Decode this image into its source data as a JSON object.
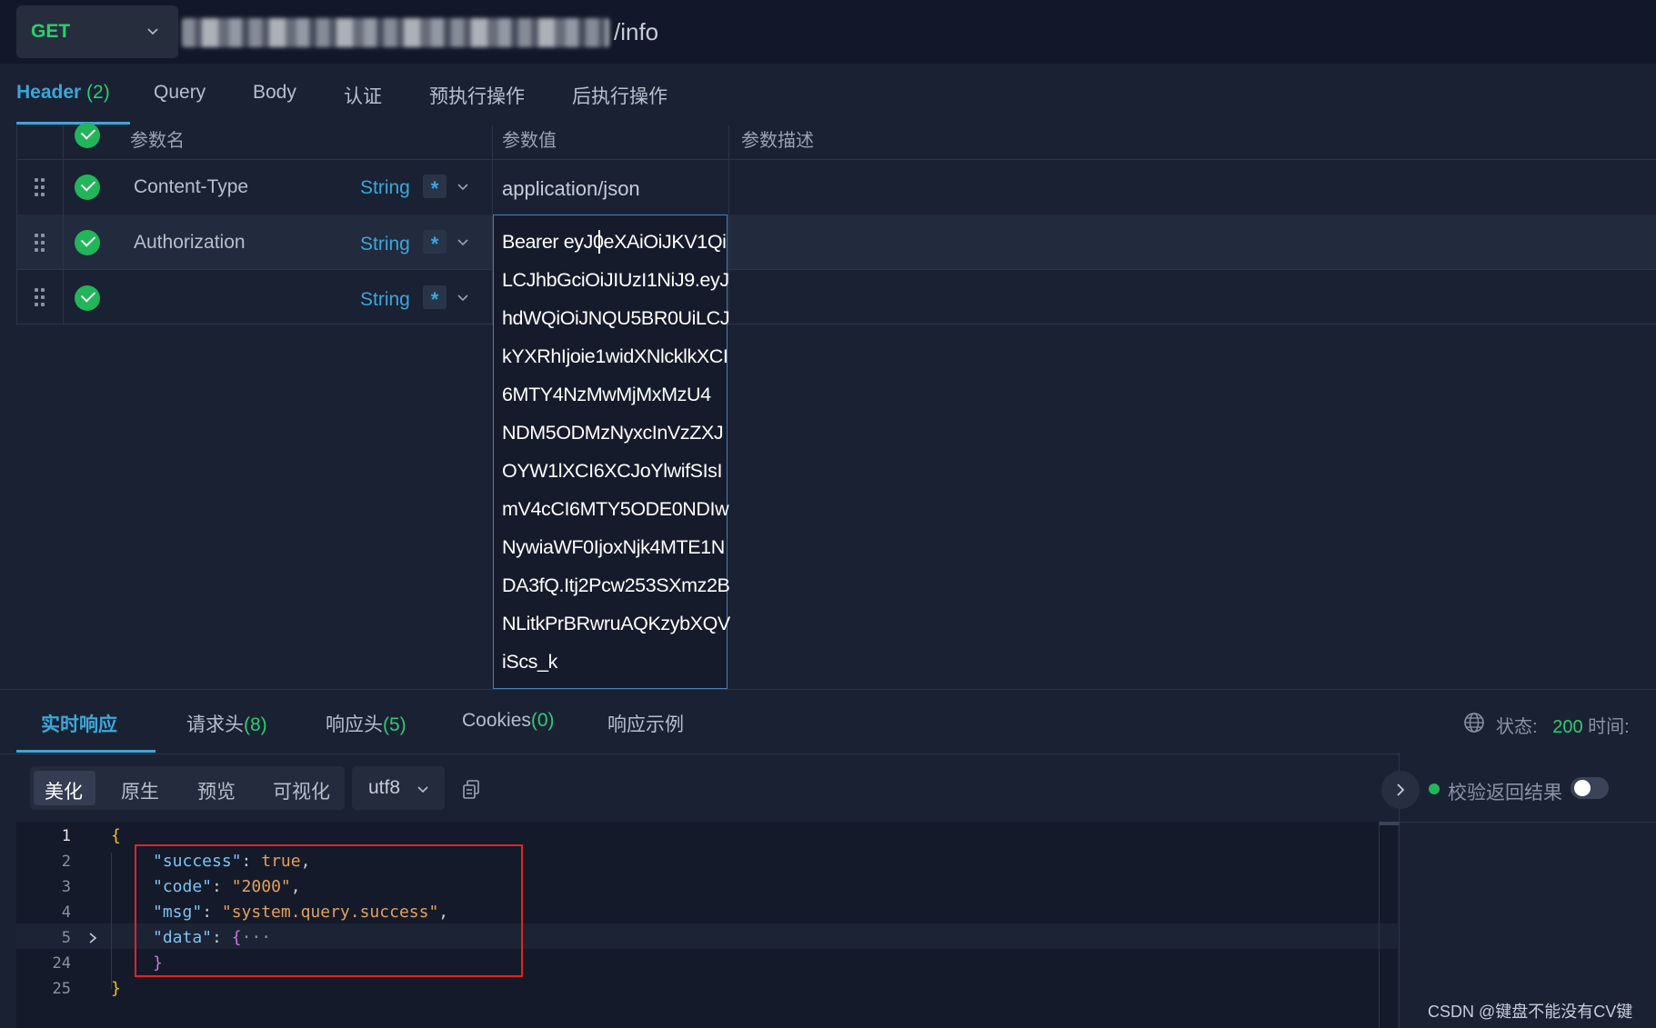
{
  "request": {
    "method": "GET",
    "url_suffix": "/info"
  },
  "request_tabs": [
    {
      "label": "Header",
      "count": "(2)"
    },
    {
      "label": "Query"
    },
    {
      "label": "Body"
    },
    {
      "label": "认证"
    },
    {
      "label": "预执行操作"
    },
    {
      "label": "后执行操作"
    }
  ],
  "params_table": {
    "headers": {
      "name": "参数名",
      "value": "参数值",
      "desc": "参数描述"
    },
    "rows": [
      {
        "name": "Content-Type",
        "type": "String",
        "required": "*",
        "value": "application/json"
      },
      {
        "name": "Authorization",
        "type": "String",
        "required": "*",
        "value": ""
      },
      {
        "name": "",
        "type": "String",
        "required": "*",
        "value": ""
      }
    ]
  },
  "value_editor": {
    "lines": [
      "Bearer eyJ0eXAiOiJKV1Qi",
      "LCJhbGciOiJIUzI1NiJ9.eyJ",
      "hdWQiOiJNQU5BR0UiLCJ",
      "kYXRhIjoie1widXNlcklkXCI",
      "6MTY4NzMwMjMxMzU4",
      "NDM5ODMzNyxcInVzZXJ",
      "OYW1lXCI6XCJoYlwifSIsI",
      "mV4cCI6MTY5ODE0NDIw",
      "NywiaWF0IjoxNjk4MTE1N",
      "DA3fQ.Itj2Pcw253SXmz2B",
      "NLitkPrBRwruAQKzybXQV",
      "iScs_k"
    ]
  },
  "response_tabs": [
    {
      "label": "实时响应"
    },
    {
      "label": "请求头",
      "count": "(8)"
    },
    {
      "label": "响应头",
      "count": "(5)"
    },
    {
      "label": "Cookies",
      "count": "(0)"
    },
    {
      "label": "响应示例"
    }
  ],
  "status": {
    "status_label": "状态:",
    "status_code": "200",
    "time_label": "时间:"
  },
  "format_tabs": [
    "美化",
    "原生",
    "预览",
    "可视化"
  ],
  "encoding": "utf8",
  "verify_label": "校验返回结果",
  "code": {
    "line_numbers": [
      "1",
      "2",
      "3",
      "4",
      "5",
      "24",
      "25"
    ],
    "open_brace": "{",
    "success_key": "\"success\"",
    "success_val": "true",
    "code_key": "\"code\"",
    "code_val": "\"2000\"",
    "msg_key": "\"msg\"",
    "msg_val": "\"system.query.success\"",
    "data_key": "\"data\"",
    "data_open": "{",
    "ellipsis": "···",
    "inner_close": "}",
    "close_brace": "}"
  },
  "watermark": "CSDN @键盘不能没有CV键",
  "colors": {
    "accent": "#3ba7d8",
    "success": "#2ecc71",
    "highlight_box": "#e02424"
  }
}
